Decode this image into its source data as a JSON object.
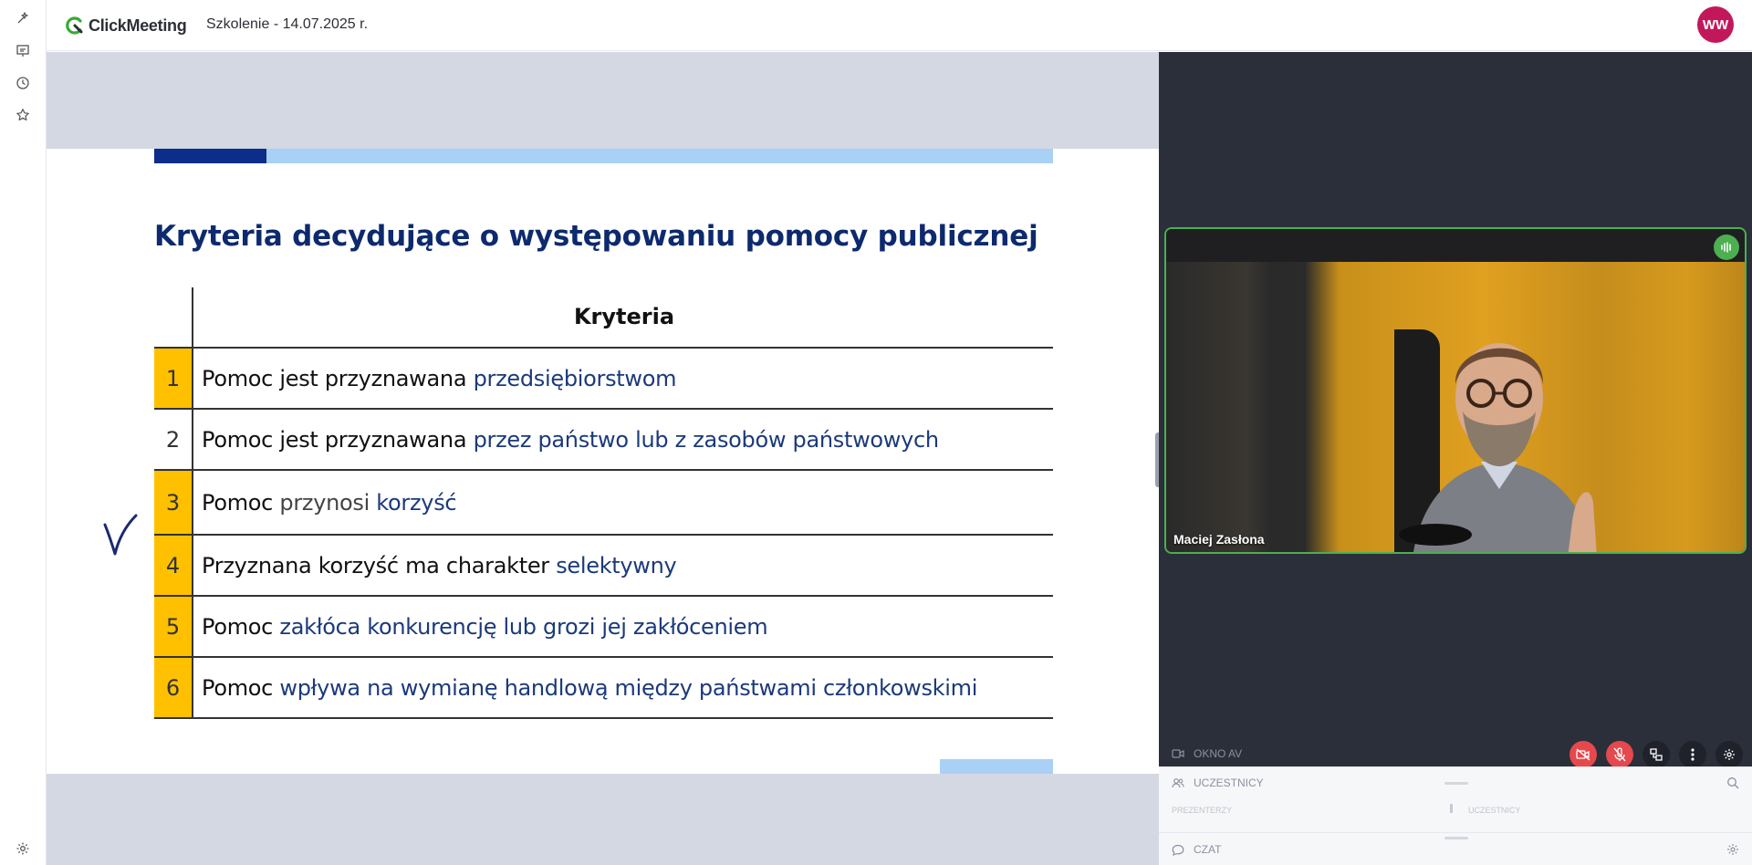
{
  "app": {
    "name": "ClickMeeting",
    "meeting_title": "Szkolenie - 14.07.2025 r.",
    "user_initials": "WW"
  },
  "left_rail": [
    {
      "name": "magic-icon"
    },
    {
      "name": "presentation-icon"
    },
    {
      "name": "history-icon"
    },
    {
      "name": "star-icon"
    }
  ],
  "slide": {
    "title": "Kryteria decydujące o występowaniu pomocy publicznej",
    "table_header": "Kryteria",
    "rows": [
      {
        "num": "1",
        "highlight": true,
        "parts": [
          {
            "t": "Pomoc jest przyznawana ",
            "c": "black"
          },
          {
            "t": "przedsiębiorstwom",
            "c": "blue"
          }
        ]
      },
      {
        "num": "2",
        "highlight": false,
        "parts": [
          {
            "t": "Pomoc jest przyznawana ",
            "c": "black"
          },
          {
            "t": "przez państwo lub z zasobów państwowych",
            "c": "blue"
          }
        ]
      },
      {
        "num": "3",
        "highlight": true,
        "parts": [
          {
            "t": "Pomoc ",
            "c": "black"
          },
          {
            "t": "przynosi ",
            "c": "grey"
          },
          {
            "t": "korzyść",
            "c": "blue"
          }
        ]
      },
      {
        "num": "4",
        "highlight": true,
        "parts": [
          {
            "t": "Przyznana korzyść ma charakter ",
            "c": "black"
          },
          {
            "t": "selektywny",
            "c": "blue"
          }
        ]
      },
      {
        "num": "5",
        "highlight": true,
        "parts": [
          {
            "t": "Pomoc ",
            "c": "black"
          },
          {
            "t": "zakłóca konkurencję lub grozi jej zakłóceniem",
            "c": "blue"
          }
        ]
      },
      {
        "num": "6",
        "highlight": true,
        "parts": [
          {
            "t": "Pomoc ",
            "c": "black"
          },
          {
            "t": "wpływa na wymianę handlową między państwami członkowskimi",
            "c": "blue"
          }
        ]
      }
    ]
  },
  "video": {
    "participant_name": "Maciej Zasłona",
    "speaking": true
  },
  "av_window": {
    "label": "OKNO AV"
  },
  "participants": {
    "label": "UCZESTNICY",
    "col_left": "PREZENTERZY",
    "col_right": "UCZESTNICY"
  },
  "chat": {
    "label": "CZAT"
  },
  "colors": {
    "accent_green": "#4caf50",
    "avatar": "#c2185b",
    "slide_title": "#0d2a6e",
    "highlight_yellow": "#ffc000",
    "mute_red": "#e5484d"
  }
}
